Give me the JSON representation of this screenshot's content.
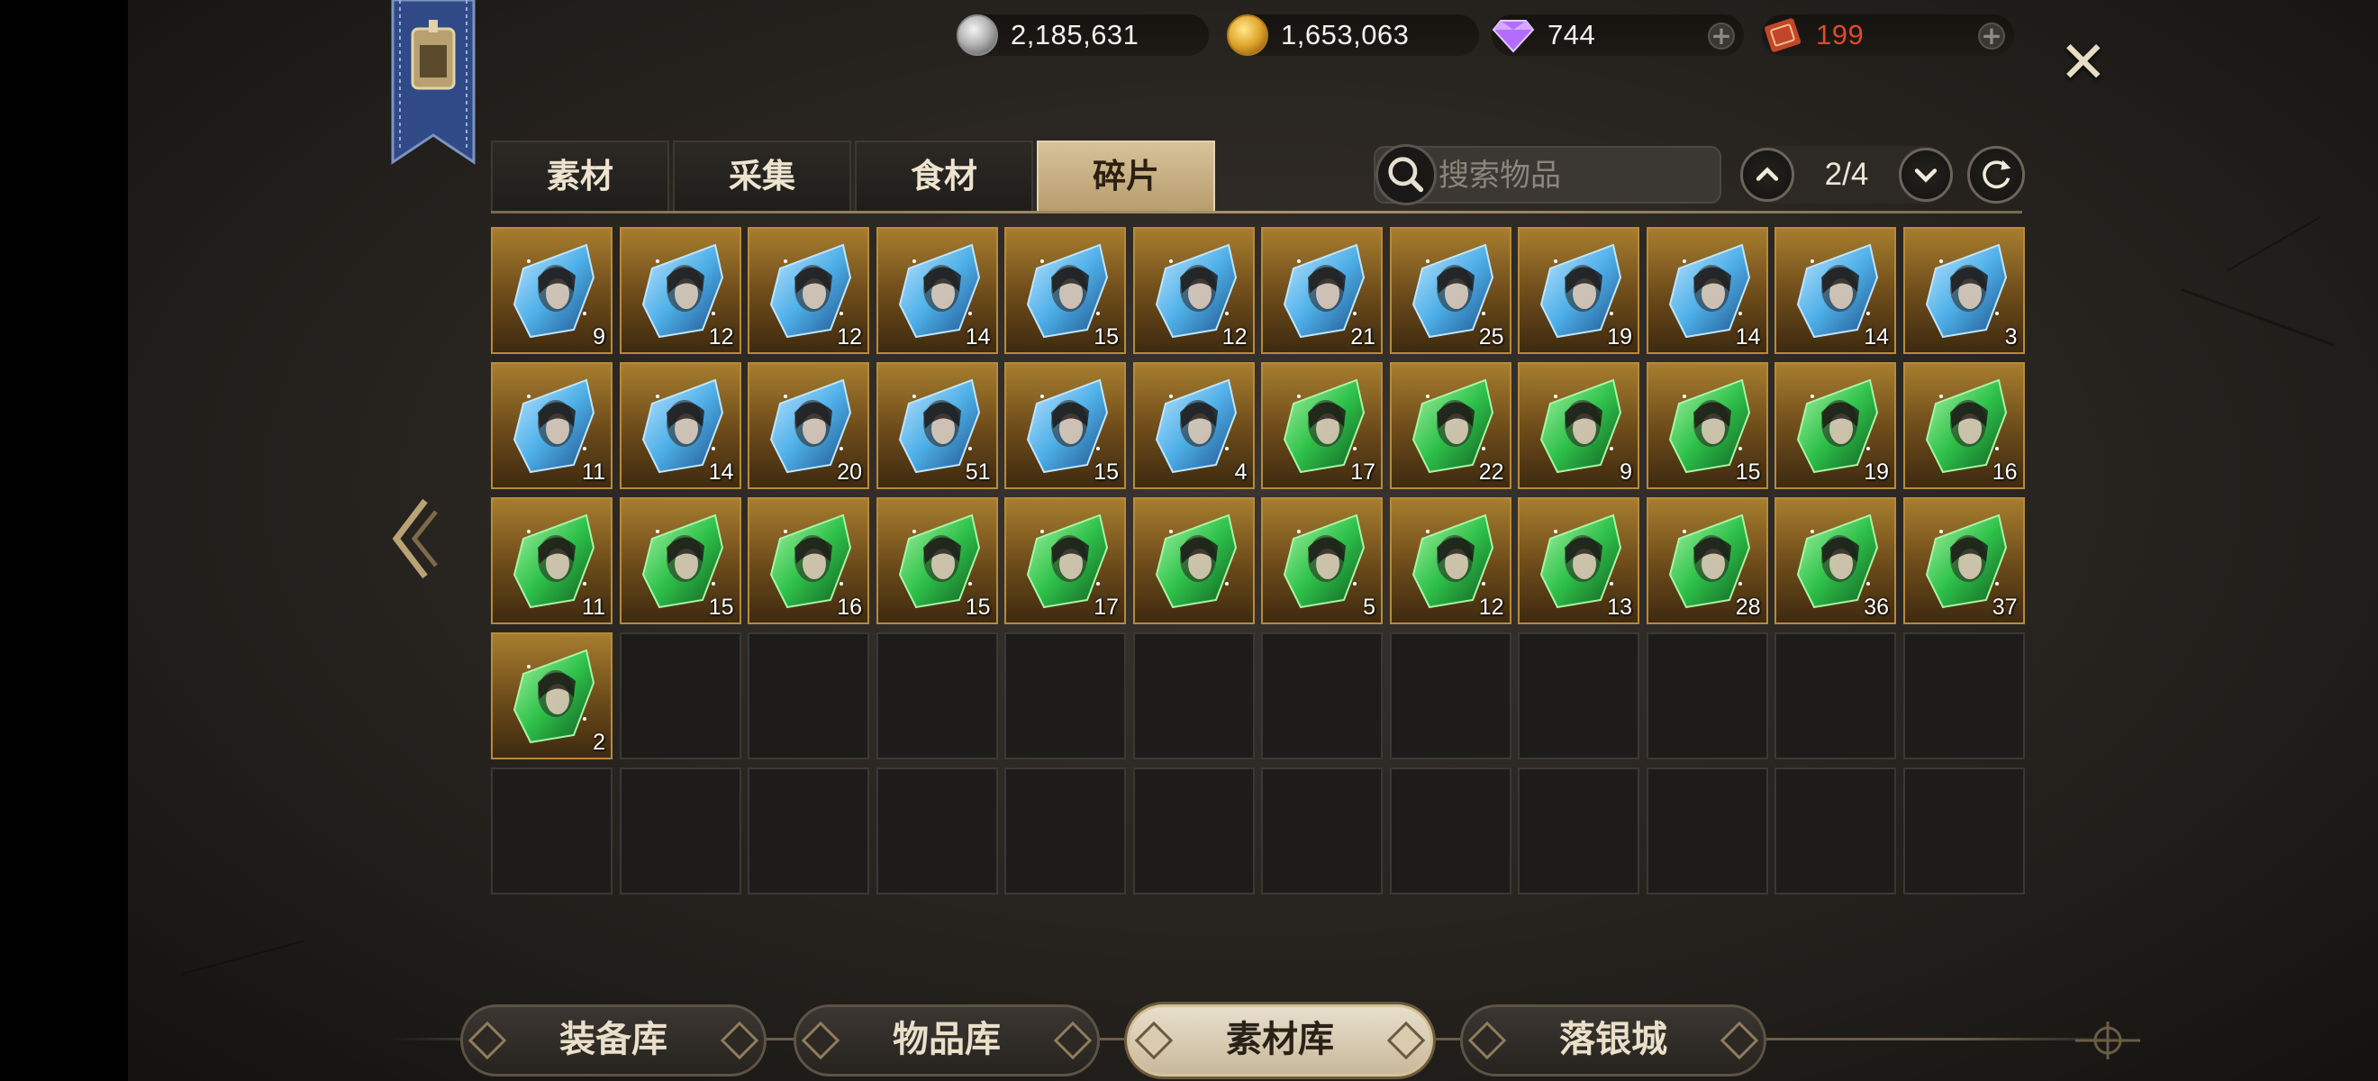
{
  "currencies": [
    {
      "id": "silver",
      "value": "2,185,631",
      "icon": "silver-coin-icon"
    },
    {
      "id": "gold",
      "value": "1,653,063",
      "icon": "gold-coin-icon"
    },
    {
      "id": "diamond",
      "value": "744",
      "icon": "diamond-icon"
    },
    {
      "id": "ticket",
      "value": "199",
      "icon": "ticket-icon",
      "color": "#e0482c"
    }
  ],
  "tabs": [
    {
      "label": "素材",
      "active": false
    },
    {
      "label": "采集",
      "active": false
    },
    {
      "label": "食材",
      "active": false
    },
    {
      "label": "碎片",
      "active": true
    }
  ],
  "search": {
    "placeholder": "搜索物品"
  },
  "pager": {
    "current": "2/4"
  },
  "colors": {
    "blue_shard": "#4fb0e8",
    "green_shard": "#2fc24a",
    "slot_gold": "#a77d2e"
  },
  "items": [
    {
      "type": "blue",
      "count": "9"
    },
    {
      "type": "blue",
      "count": "12"
    },
    {
      "type": "blue",
      "count": "12"
    },
    {
      "type": "blue",
      "count": "14"
    },
    {
      "type": "blue",
      "count": "15"
    },
    {
      "type": "blue",
      "count": "12"
    },
    {
      "type": "blue",
      "count": "21"
    },
    {
      "type": "blue",
      "count": "25"
    },
    {
      "type": "blue",
      "count": "19"
    },
    {
      "type": "blue",
      "count": "14"
    },
    {
      "type": "blue",
      "count": "14"
    },
    {
      "type": "blue",
      "count": "3"
    },
    {
      "type": "blue",
      "count": "11"
    },
    {
      "type": "blue",
      "count": "14"
    },
    {
      "type": "blue",
      "count": "20"
    },
    {
      "type": "blue",
      "count": "51"
    },
    {
      "type": "blue",
      "count": "15"
    },
    {
      "type": "blue",
      "count": "4"
    },
    {
      "type": "green",
      "count": "17"
    },
    {
      "type": "green",
      "count": "22"
    },
    {
      "type": "green",
      "count": "9"
    },
    {
      "type": "green",
      "count": "15"
    },
    {
      "type": "green",
      "count": "19"
    },
    {
      "type": "green",
      "count": "16"
    },
    {
      "type": "green",
      "count": "11"
    },
    {
      "type": "green",
      "count": "15"
    },
    {
      "type": "green",
      "count": "16"
    },
    {
      "type": "green",
      "count": "15"
    },
    {
      "type": "green",
      "count": "17"
    },
    {
      "type": "green",
      "count": ""
    },
    {
      "type": "green",
      "count": "5"
    },
    {
      "type": "green",
      "count": "12"
    },
    {
      "type": "green",
      "count": "13"
    },
    {
      "type": "green",
      "count": "28"
    },
    {
      "type": "green",
      "count": "36"
    },
    {
      "type": "green",
      "count": "37"
    },
    {
      "type": "green",
      "count": "2"
    }
  ],
  "total_slots": 60,
  "bottom_nav": [
    {
      "label": "装备库",
      "active": false
    },
    {
      "label": "物品库",
      "active": false
    },
    {
      "label": "素材库",
      "active": true
    },
    {
      "label": "落银城",
      "active": false
    }
  ],
  "close_label": "✕"
}
